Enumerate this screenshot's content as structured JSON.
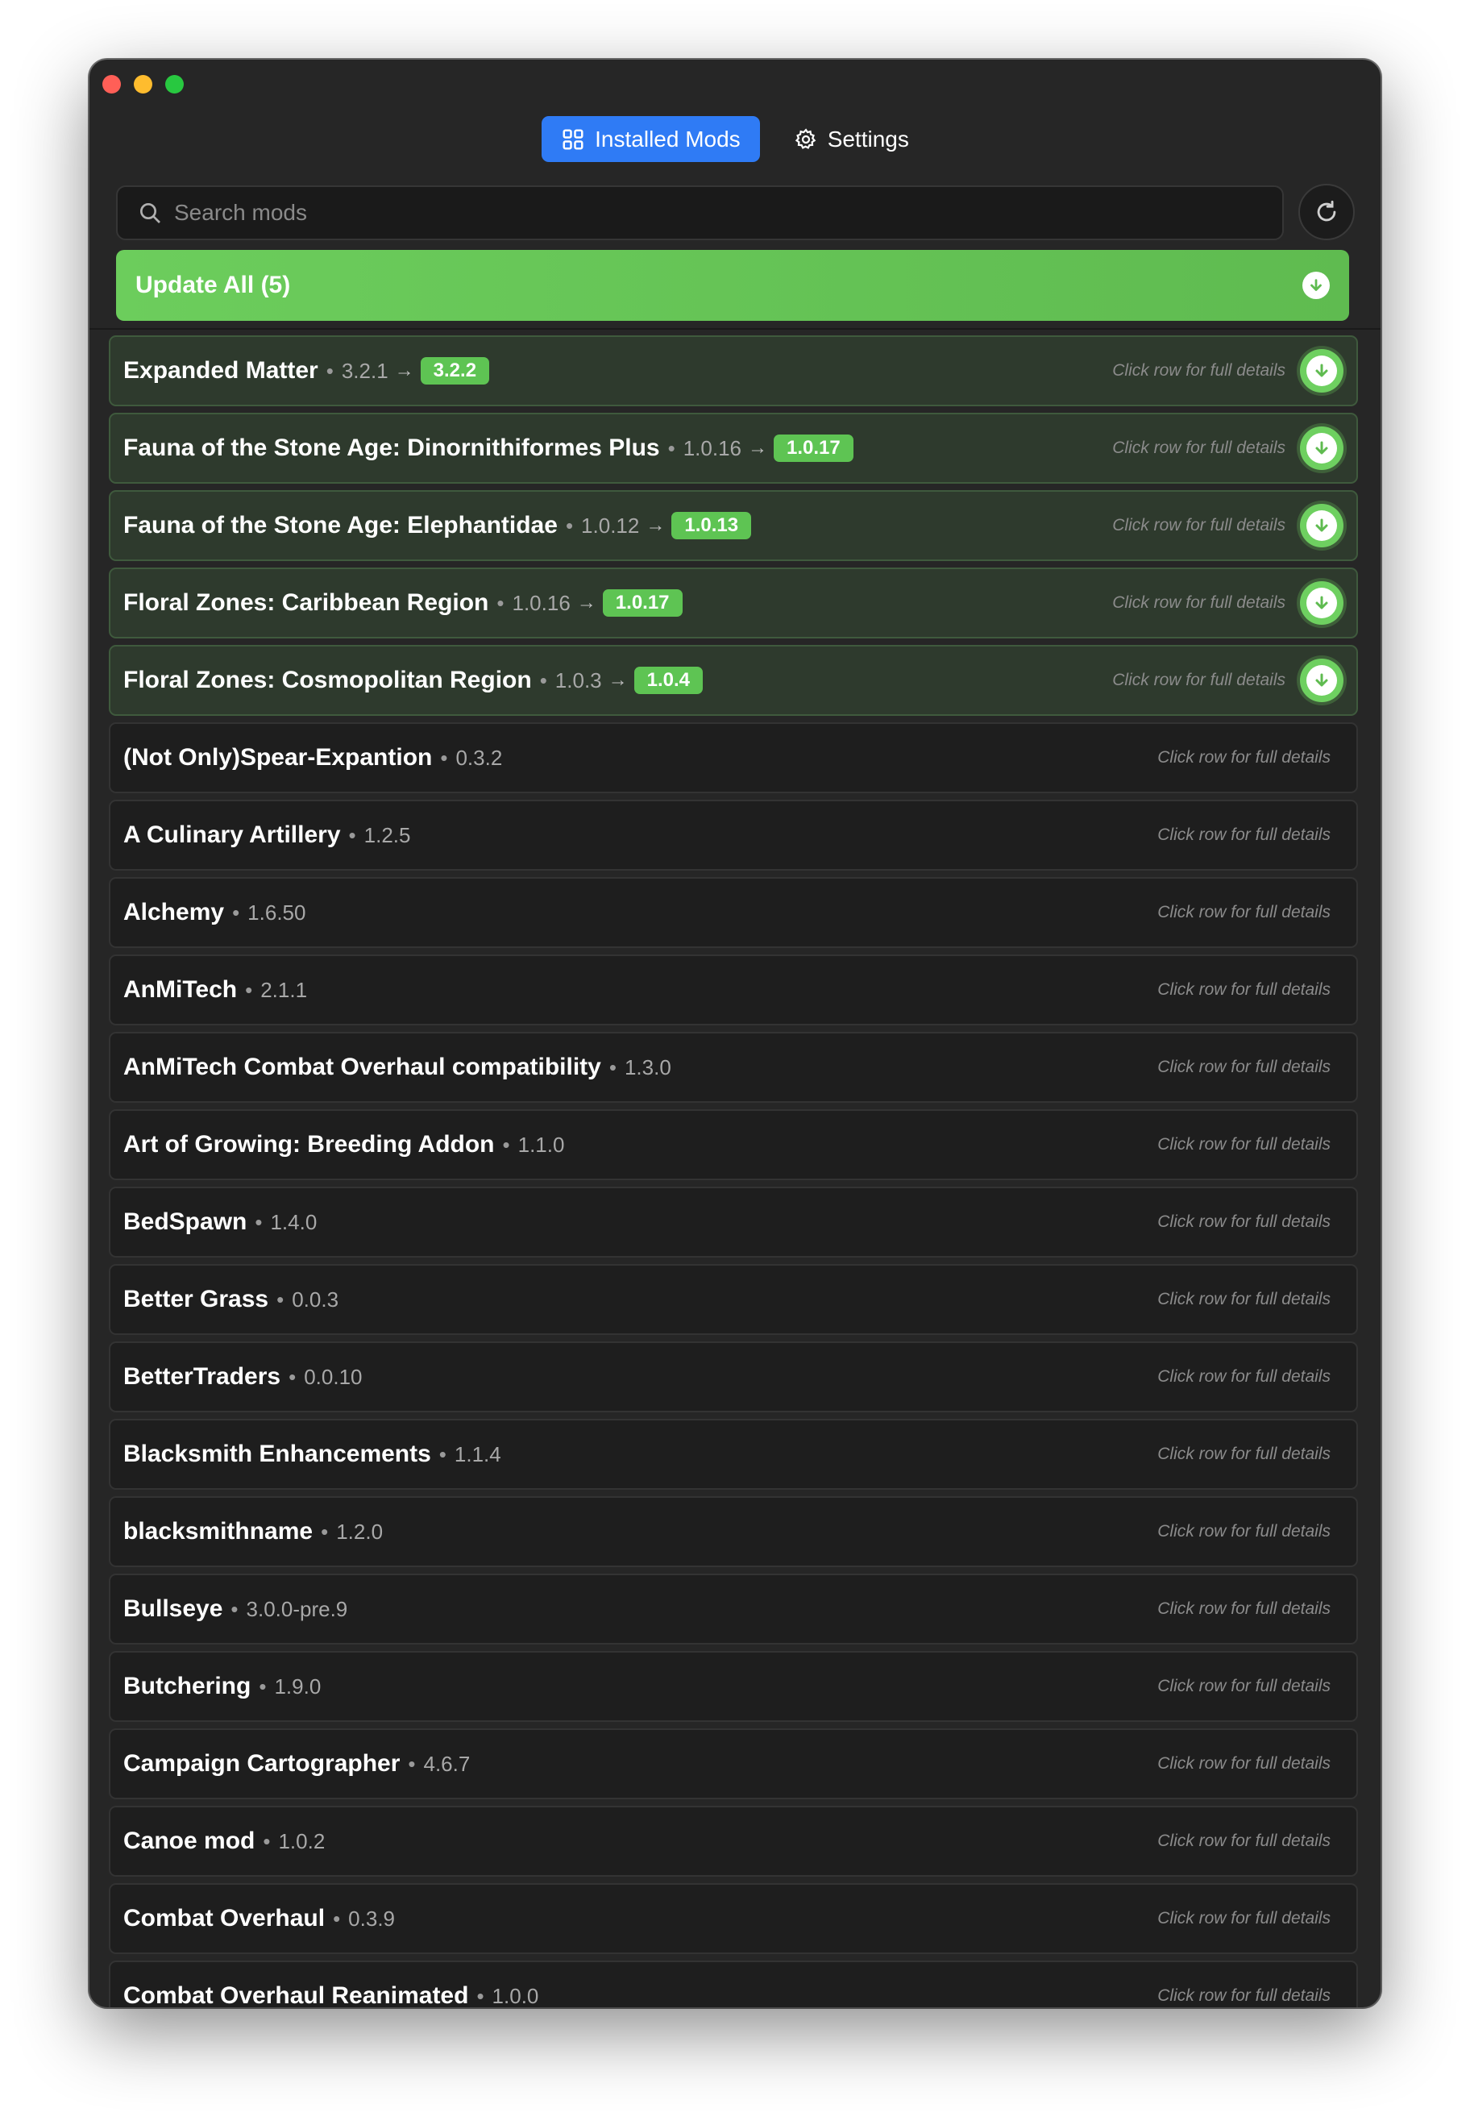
{
  "tabs": [
    {
      "label": "Installed Mods",
      "icon": "grid-icon",
      "active": true
    },
    {
      "label": "Settings",
      "icon": "gear-icon",
      "active": false
    }
  ],
  "search": {
    "placeholder": "Search mods",
    "value": ""
  },
  "update_all": {
    "label": "Update All (5)"
  },
  "hint_text": "Click row for full details",
  "colors": {
    "accent": "#2f7bf5",
    "update_green": "#6ccd5c",
    "background": "#262626"
  },
  "updates": [
    {
      "name": "Expanded Matter",
      "version": "3.2.1",
      "new_version": "3.2.2"
    },
    {
      "name": "Fauna of the Stone Age: Dinornithiformes Plus",
      "version": "1.0.16",
      "new_version": "1.0.17"
    },
    {
      "name": "Fauna of the Stone Age: Elephantidae",
      "version": "1.0.12",
      "new_version": "1.0.13"
    },
    {
      "name": "Floral Zones: Caribbean Region",
      "version": "1.0.16",
      "new_version": "1.0.17"
    },
    {
      "name": "Floral Zones: Cosmopolitan Region",
      "version": "1.0.3",
      "new_version": "1.0.4"
    }
  ],
  "mods": [
    {
      "name": "(Not Only)Spear-Expantion",
      "version": "0.3.2"
    },
    {
      "name": "A Culinary Artillery",
      "version": "1.2.5"
    },
    {
      "name": "Alchemy",
      "version": "1.6.50"
    },
    {
      "name": "AnMiTech",
      "version": "2.1.1"
    },
    {
      "name": "AnMiTech Combat Overhaul compatibility",
      "version": "1.3.0"
    },
    {
      "name": "Art of Growing: Breeding Addon",
      "version": "1.1.0"
    },
    {
      "name": "BedSpawn",
      "version": "1.4.0"
    },
    {
      "name": "Better Grass",
      "version": "0.0.3"
    },
    {
      "name": "BetterTraders",
      "version": "0.0.10"
    },
    {
      "name": "Blacksmith Enhancements",
      "version": "1.1.4"
    },
    {
      "name": "blacksmithname",
      "version": "1.2.0"
    },
    {
      "name": "Bullseye",
      "version": "3.0.0-pre.9"
    },
    {
      "name": "Butchering",
      "version": "1.9.0"
    },
    {
      "name": "Campaign Cartographer",
      "version": "4.6.7"
    },
    {
      "name": "Canoe mod",
      "version": "1.0.2"
    },
    {
      "name": "Combat Overhaul",
      "version": "0.3.9"
    },
    {
      "name": "Combat Overhaul Reanimated",
      "version": "1.0.0"
    }
  ]
}
